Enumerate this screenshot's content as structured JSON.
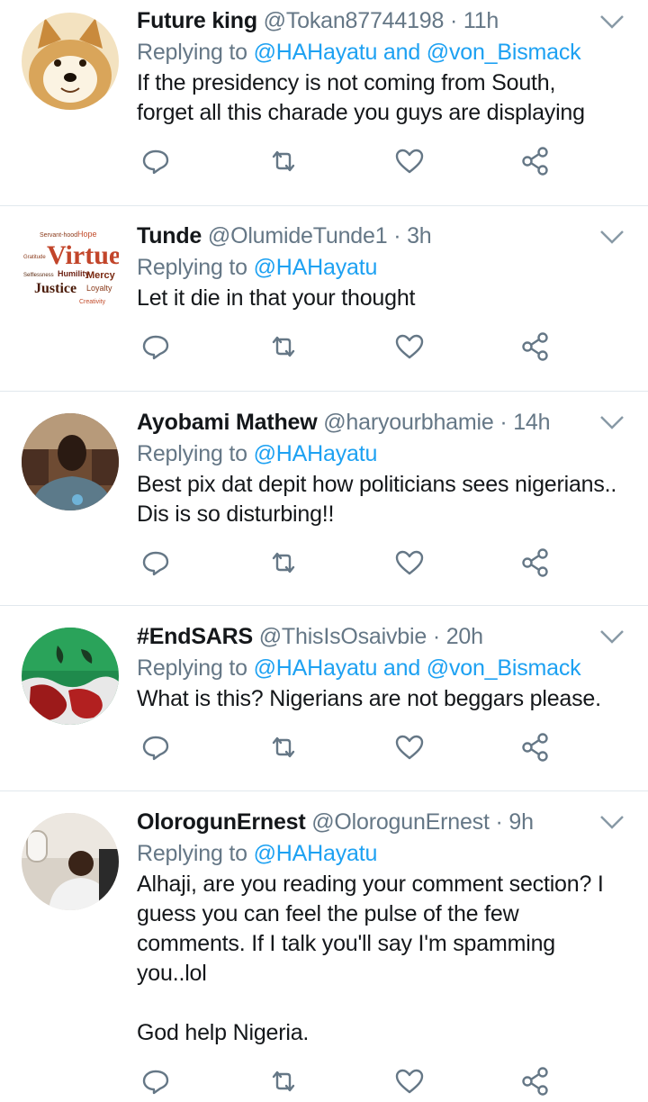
{
  "tweets": [
    {
      "name": "Future king",
      "handle": "@Tokan87744198",
      "time": "11h",
      "replying_prefix": "Replying to",
      "mentions": [
        "@HAHayatu",
        "@von_Bismack"
      ],
      "mention_joiner": "and",
      "text": "If the presidency is not coming from South, forget all this charade you guys are displaying",
      "avatar_icon": "shiba-dog-avatar"
    },
    {
      "name": "Tunde",
      "handle": "@OlumideTunde1",
      "time": "3h",
      "replying_prefix": "Replying to",
      "mentions": [
        "@HAHayatu"
      ],
      "text": "Let it die in that your thought",
      "avatar_icon": "word-cloud-avatar",
      "avatar_words": [
        "Virtue",
        "Hope",
        "Humility",
        "Mercy",
        "Justice",
        "Loyalty",
        "Creativity",
        "Servant-hood",
        "Gratitude",
        "Selflessness"
      ]
    },
    {
      "name": "Ayobami Mathew",
      "handle": "@haryourbhamie",
      "time": "14h",
      "replying_prefix": "Replying to",
      "mentions": [
        "@HAHayatu"
      ],
      "text": "Best pix dat depit how politicians sees nigerians.. Dis is so disturbing!!",
      "avatar_icon": "person-photo-avatar"
    },
    {
      "name": "#EndSARS",
      "handle": "@ThisIsOsaivbie",
      "time": "20h",
      "replying_prefix": "Replying to",
      "mentions": [
        "@HAHayatu",
        "@von_Bismack"
      ],
      "mention_joiner": "and",
      "text": "What is this? Nigerians are not beggars please.",
      "avatar_icon": "flag-blood-avatar"
    },
    {
      "name": "OlorogunErnest",
      "handle": "@OlorogunErnest",
      "time": "9h",
      "replying_prefix": "Replying to",
      "mentions": [
        "@HAHayatu"
      ],
      "text": "Alhaji, are you reading your comment section? I guess you can feel the pulse of the few comments. If I talk you'll say I'm spamming you..lol\n\nGod help Nigeria.",
      "avatar_icon": "man-in-plane-avatar"
    }
  ],
  "separator": "·",
  "action_icons": [
    "reply-icon",
    "retweet-icon",
    "like-icon",
    "share-icon"
  ],
  "colors": {
    "accent": "#1da1f2",
    "secondary": "#657786",
    "text": "#14171a",
    "divider": "#e1e8ed"
  }
}
